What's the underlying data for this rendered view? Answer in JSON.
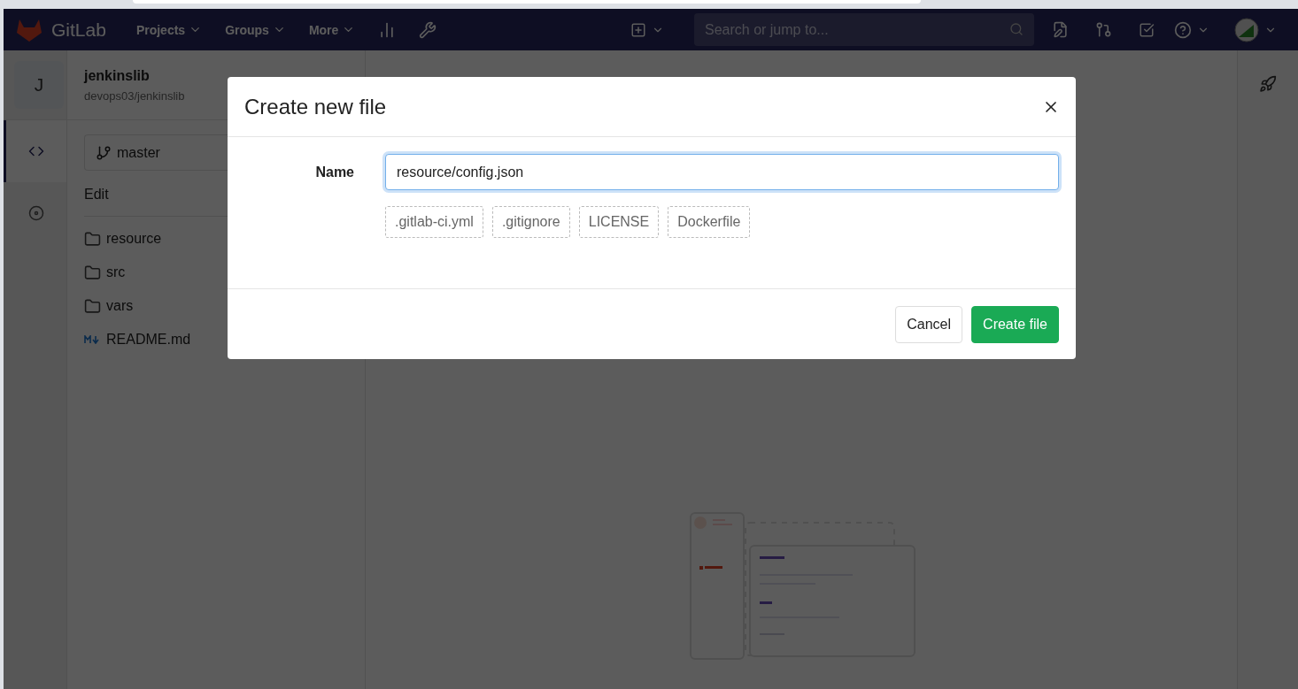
{
  "header": {
    "brand": "GitLab",
    "nav": [
      {
        "label": "Projects"
      },
      {
        "label": "Groups"
      },
      {
        "label": "More"
      }
    ],
    "search": {
      "placeholder": "Search or jump to..."
    }
  },
  "project": {
    "avatar_letter": "J",
    "name": "jenkinslib",
    "path": "devops03/jenkinslib"
  },
  "nav_rail": [
    {
      "kind": "code",
      "selected": true
    },
    {
      "kind": "issues",
      "selected": false
    }
  ],
  "branch": "master",
  "edit_label": "Edit",
  "files": [
    {
      "name": "resource",
      "kind": "folder"
    },
    {
      "name": "src",
      "kind": "folder"
    },
    {
      "name": "vars",
      "kind": "folder"
    },
    {
      "name": "README.md",
      "kind": "markdown"
    }
  ],
  "dialog": {
    "title": "Create new file",
    "field_label": "Name",
    "field_value": "resource/config.json",
    "templates": [
      ".gitlab-ci.yml",
      ".gitignore",
      "LICENSE",
      "Dockerfile"
    ],
    "buttons": [
      {
        "label": "Cancel",
        "kind": "secondary"
      },
      {
        "label": "Create file",
        "kind": "primary"
      }
    ]
  }
}
